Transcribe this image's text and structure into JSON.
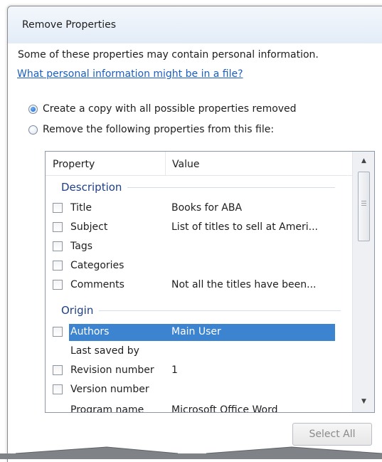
{
  "dialog": {
    "title": "Remove Properties",
    "description": "Some of these properties may contain personal information.",
    "help_link": "What personal information might be in a file?",
    "options": [
      {
        "label": "Create a copy with all possible properties removed",
        "selected": true
      },
      {
        "label": "Remove the following properties from this file:",
        "selected": false
      }
    ],
    "columns": {
      "property": "Property",
      "value": "Value"
    },
    "groups": {
      "description": "Description",
      "origin": "Origin"
    },
    "description_rows": [
      {
        "property": "Title",
        "value": "Books for ABA",
        "checked": false
      },
      {
        "property": "Subject",
        "value": "List of titles to sell at Ameri...",
        "checked": false
      },
      {
        "property": "Tags",
        "value": "",
        "checked": false
      },
      {
        "property": "Categories",
        "value": "",
        "checked": false
      },
      {
        "property": "Comments",
        "value": "Not all the titles have been...",
        "checked": false
      }
    ],
    "origin_rows": [
      {
        "property": "Authors",
        "value": "Main User",
        "checked": false,
        "selected": true
      },
      {
        "property": "Last saved by",
        "value": "",
        "checkbox": false
      },
      {
        "property": "Revision number",
        "value": "1",
        "checked": false
      },
      {
        "property": "Version number",
        "value": "",
        "checked": false
      },
      {
        "property": "Program name",
        "value": "Microsoft Office Word",
        "checkbox": false
      }
    ],
    "select_all_label": "Select All",
    "colors": {
      "link": "#1c5ec0",
      "group_heading": "#1e3f8a",
      "selection": "#3d84d0"
    }
  }
}
